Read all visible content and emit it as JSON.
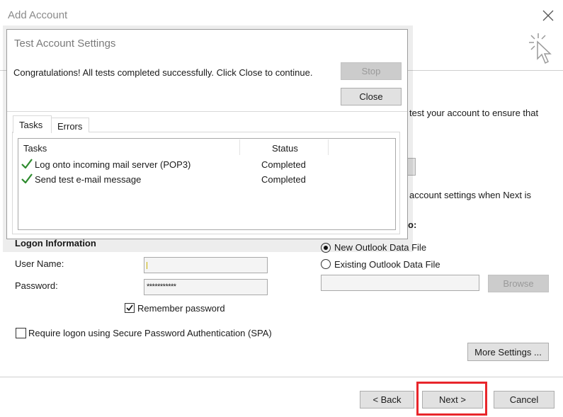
{
  "window": {
    "title": "Add Account"
  },
  "partial_background_text": {
    "line1": "test your account to ensure that",
    "line2": "account settings when Next is",
    "line3": "o:"
  },
  "logon": {
    "heading": "Logon Information",
    "username_label": "User Name:",
    "username_value": "",
    "password_label": "Password:",
    "password_value": "***********",
    "remember_label": "Remember password",
    "remember_checked": true,
    "spa_label": "Require logon using Secure Password Authentication (SPA)",
    "spa_checked": false
  },
  "deliver": {
    "new_file_label": "New Outlook Data File",
    "existing_file_label": "Existing Outlook Data File",
    "selected": "new",
    "path_value": "",
    "browse_label": "Browse"
  },
  "more_settings_label": "More Settings ...",
  "footer": {
    "back_label": "< Back",
    "next_label": "Next >",
    "cancel_label": "Cancel"
  },
  "colors": {
    "highlight": "#e8262b",
    "check": "#2e8b2e"
  },
  "dialog": {
    "title": "Test Account Settings",
    "message": "Congratulations! All tests completed successfully. Click Close to continue.",
    "stop_label": "Stop",
    "close_label": "Close",
    "tabs": [
      {
        "label": "Tasks",
        "active": true
      },
      {
        "label": "Errors",
        "active": false
      }
    ],
    "columns": [
      "Tasks",
      "Status"
    ],
    "rows": [
      {
        "icon": "checkmark-icon",
        "task": "Log onto incoming mail server (POP3)",
        "status": "Completed"
      },
      {
        "icon": "checkmark-icon",
        "task": "Send test e-mail message",
        "status": "Completed"
      }
    ]
  }
}
